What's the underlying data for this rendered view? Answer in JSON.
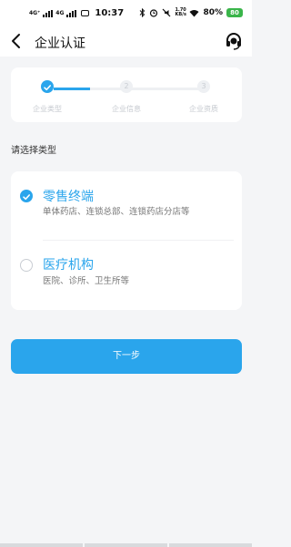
{
  "status_bar": {
    "signal_1": "4G⁺",
    "signal_2": "4G",
    "time": "10:37",
    "battery": "80%",
    "battery_label": "80",
    "network_speed": "1.70\nKB/s"
  },
  "nav": {
    "title": "企业认证",
    "back_icon": "chevron-left-icon",
    "service_icon": "headset-icon"
  },
  "steps": [
    {
      "label": "企业类型",
      "state": "active"
    },
    {
      "label": "企业信息",
      "state": "todo",
      "num": "2"
    },
    {
      "label": "企业资质",
      "state": "todo",
      "num": "3"
    }
  ],
  "form": {
    "section_label": "请选择类型",
    "options": [
      {
        "title": "零售终端",
        "desc": "单体药店、连锁总部、连锁药店分店等",
        "checked": true
      },
      {
        "title": "医疗机构",
        "desc": "医院、诊所、卫生所等",
        "checked": false
      }
    ]
  },
  "next_label": "下一步",
  "colors": {
    "accent": "#2aa5ec",
    "card": "#ffffff",
    "background": "#f4f5f7"
  }
}
